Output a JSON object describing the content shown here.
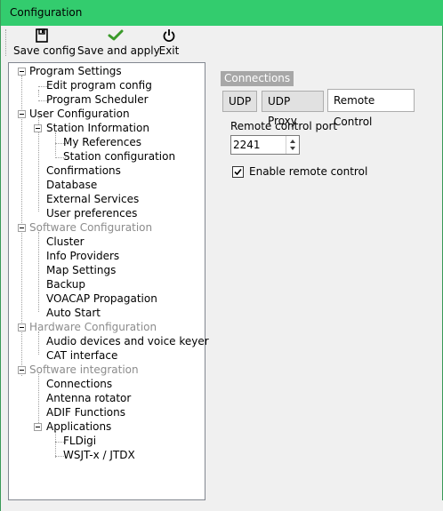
{
  "window": {
    "title": "Configuration",
    "accent": "#33cc6e"
  },
  "toolbar": {
    "save_config_label": "Save config",
    "save_apply_label": "Save and apply",
    "exit_label": "Exit"
  },
  "tree": {
    "program_settings": "Program Settings",
    "edit_program_config": "Edit program config",
    "program_scheduler": "Program Scheduler",
    "user_configuration": "User Configuration",
    "station_information": "Station Information",
    "my_references": "My References",
    "station_configuration": "Station configuration",
    "confirmations": "Confirmations",
    "database": "Database",
    "external_services": "External Services",
    "user_preferences": "User preferences",
    "software_configuration": "Software Configuration",
    "cluster": "Cluster",
    "info_providers": "Info Providers",
    "map_settings": "Map Settings",
    "backup": "Backup",
    "voacap": "VOACAP Propagation",
    "auto_start": "Auto Start",
    "hardware_configuration": "Hardware Configuration",
    "audio_devices": "Audio devices and voice keyer",
    "cat_interface": "CAT interface",
    "software_integration": "Software integration",
    "connections": "Connections",
    "antenna_rotator": "Antenna rotator",
    "adif_functions": "ADIF Functions",
    "applications": "Applications",
    "fldigi": "FLDigi",
    "wsjt": "WSJT-x / JTDX"
  },
  "panel": {
    "group_label": "Connections",
    "tabs": [
      "UDP",
      "UDP Proxy",
      "Remote Control"
    ],
    "active_tab": "Remote Control",
    "port_label": "Remote control port",
    "port_value": "2241",
    "enable_label": "Enable remote control",
    "enable_checked": true
  }
}
